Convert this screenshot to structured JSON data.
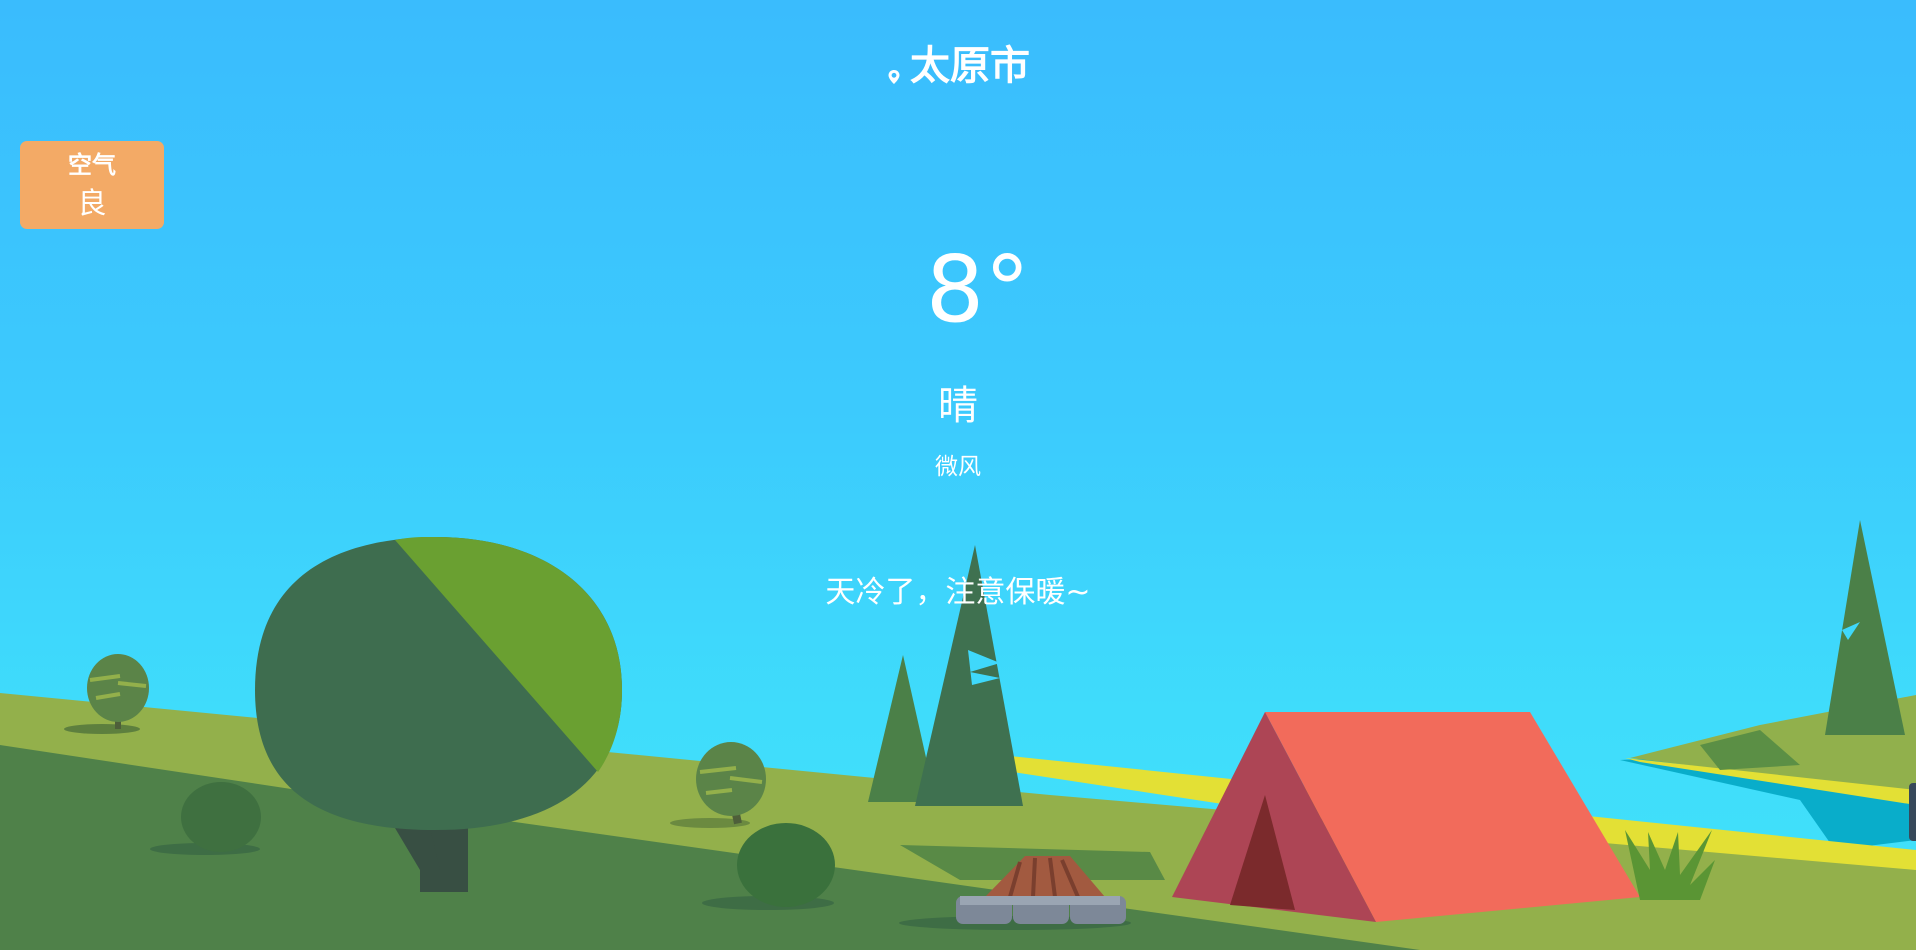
{
  "location": {
    "city": "太原市",
    "icon": "location-pin-icon"
  },
  "air_quality": {
    "label": "空气",
    "value": "良",
    "color": "#f3aa66"
  },
  "weather": {
    "temperature": "8°",
    "condition": "晴",
    "wind": "微风",
    "tip": "天冷了，注意保暖~"
  },
  "colors": {
    "sky_top": "#3abcfd",
    "sky_bottom": "#42e2fa",
    "grass_light": "#93b04b",
    "grass_dark": "#4f8149",
    "tent": "#f26b5b",
    "tree_dark": "#3e6d4f",
    "tree_light": "#6aa031"
  }
}
